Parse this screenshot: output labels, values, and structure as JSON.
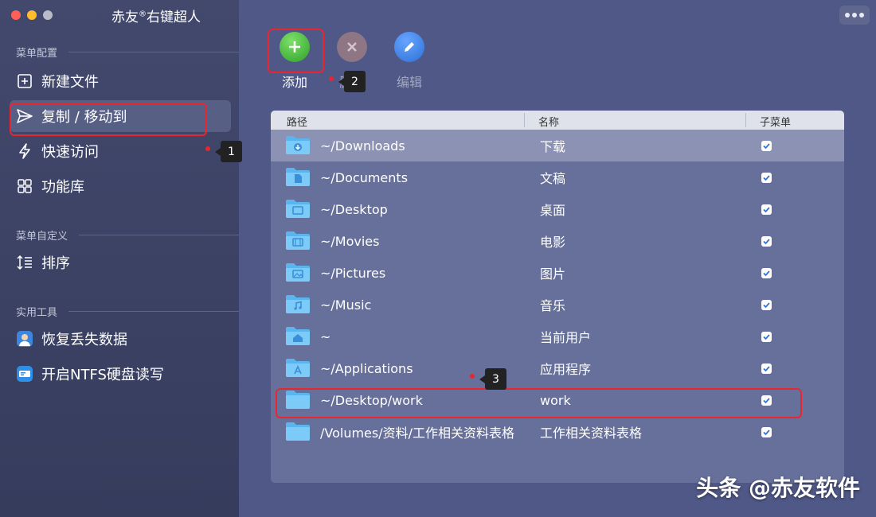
{
  "window": {
    "title": "赤友",
    "title_mark": "®",
    "title_suffix": "右键超人"
  },
  "sidebar": {
    "section_menu_config": "菜单配置",
    "section_menu_custom": "菜单自定义",
    "section_tools": "实用工具",
    "items": [
      {
        "label": "新建文件",
        "icon": "new-file-icon",
        "active": false
      },
      {
        "label": "复制 / 移动到",
        "icon": "send-icon",
        "active": true
      },
      {
        "label": "快速访问",
        "icon": "lightning-icon",
        "active": false
      },
      {
        "label": "功能库",
        "icon": "grid-icon",
        "active": false
      },
      {
        "label": "排序",
        "icon": "sort-icon",
        "active": false
      },
      {
        "label": "恢复丢失数据",
        "icon": "recovery-app-icon",
        "active": false
      },
      {
        "label": "开启NTFS硬盘读写",
        "icon": "ntfs-app-icon",
        "active": false
      }
    ]
  },
  "toolbar": {
    "add_label": "添加",
    "delete_label": "删除",
    "edit_label": "编辑"
  },
  "table": {
    "columns": [
      "路径",
      "名称",
      "子菜单"
    ],
    "rows": [
      {
        "path": "~/Downloads",
        "name": "下载",
        "submenu": true,
        "icon": "download-folder-icon",
        "selected": true
      },
      {
        "path": "~/Documents",
        "name": "文稿",
        "submenu": true,
        "icon": "document-folder-icon"
      },
      {
        "path": "~/Desktop",
        "name": "桌面",
        "submenu": true,
        "icon": "desktop-folder-icon"
      },
      {
        "path": "~/Movies",
        "name": "电影",
        "submenu": true,
        "icon": "movies-folder-icon"
      },
      {
        "path": "~/Pictures",
        "name": "图片",
        "submenu": true,
        "icon": "pictures-folder-icon"
      },
      {
        "path": "~/Music",
        "name": "音乐",
        "submenu": true,
        "icon": "music-folder-icon"
      },
      {
        "path": "~",
        "name": "当前用户",
        "submenu": true,
        "icon": "home-folder-icon"
      },
      {
        "path": "~/Applications",
        "name": "应用程序",
        "submenu": true,
        "icon": "applications-folder-icon"
      },
      {
        "path": "~/Desktop/work",
        "name": "work",
        "submenu": true,
        "icon": "folder-icon"
      },
      {
        "path": "/Volumes/资料/工作相关资料表格",
        "name": "工作相关资料表格",
        "submenu": true,
        "icon": "folder-icon"
      }
    ]
  },
  "annotations": {
    "marker1": "1",
    "marker2": "2",
    "marker3": "3"
  },
  "watermark": "头条 @赤友软件",
  "colors": {
    "accent_red": "#e8262e",
    "add_green": "#2ea02a",
    "edit_blue": "#2d6fd6"
  }
}
